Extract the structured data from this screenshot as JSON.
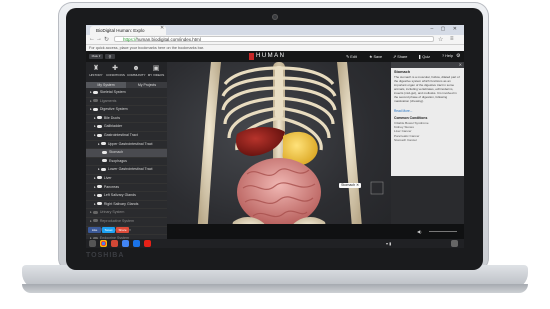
{
  "browser": {
    "tab_title": "BioDigital Human: Explo",
    "url_scheme": "https://",
    "url_rest": "human.biodigital.com/index.html",
    "bookmarks_hint": "For quick access, place your bookmarks here on the bookmarks bar."
  },
  "laptop": {
    "brand": "TOSHIBA"
  },
  "app": {
    "logo": "HUMAN",
    "toolbar": [
      "Edit",
      "Save",
      "Share",
      "Quiz",
      "Help"
    ],
    "categories": [
      "HISTORY",
      "CONDITIONS",
      "COMMUNITY",
      "MY VIDEOS"
    ],
    "side_tabs": [
      "My System",
      "My Projects"
    ],
    "tree": [
      {
        "label": "Skeletal System",
        "indent": 0,
        "state": "on"
      },
      {
        "label": "Ligaments",
        "indent": 0,
        "state": "off"
      },
      {
        "label": "Digestive System",
        "indent": 0,
        "state": "on"
      },
      {
        "label": "Bile Ducts",
        "indent": 1,
        "state": "on"
      },
      {
        "label": "Gallbladder",
        "indent": 1,
        "state": "on"
      },
      {
        "label": "Gastrointestinal Tract",
        "indent": 1,
        "state": "on"
      },
      {
        "label": "Upper Gastrointestinal Tract",
        "indent": 2,
        "state": "on"
      },
      {
        "label": "Stomach",
        "indent": 3,
        "state": "on",
        "selected": true
      },
      {
        "label": "Esophagus",
        "indent": 3,
        "state": "on"
      },
      {
        "label": "Lower Gastrointestinal Tract",
        "indent": 2,
        "state": "on"
      },
      {
        "label": "Liver",
        "indent": 1,
        "state": "on"
      },
      {
        "label": "Pancreas",
        "indent": 1,
        "state": "on"
      },
      {
        "label": "Left Salivary Glands",
        "indent": 1,
        "state": "on"
      },
      {
        "label": "Right Salivary Glands",
        "indent": 1,
        "state": "on"
      },
      {
        "label": "Urinary System",
        "indent": 0,
        "state": "off"
      },
      {
        "label": "Reproductive System",
        "indent": 0,
        "state": "off"
      },
      {
        "label": "Respiratory System",
        "indent": 0,
        "state": "off"
      },
      {
        "label": "Endocrine System",
        "indent": 0,
        "state": "off"
      }
    ],
    "info": {
      "title": "Stomach",
      "body": "The stomach is a muscular, hollow, dilated part of the digestive system which functions as an important organ of the digestive tract in some animals, including vertebrates, echinoderms, insects (mid-gut), and mollusks. It is involved in the second phase of digestion, following mastication (chewing).",
      "read_more": "Read More...",
      "conditions_heading": "Common Conditions",
      "conditions": [
        "Irritable Bowel Syndrome",
        "Kidney Stones",
        "Liver Cancer",
        "Pancreatic Cancer",
        "Stomach Cancer"
      ]
    },
    "tooltip": "Stomach",
    "social": [
      "Like",
      "Tweet",
      "Share"
    ]
  },
  "colors": {
    "accent": "#c62828",
    "twitter": "#1da1f2",
    "facebook": "#3b5998"
  }
}
